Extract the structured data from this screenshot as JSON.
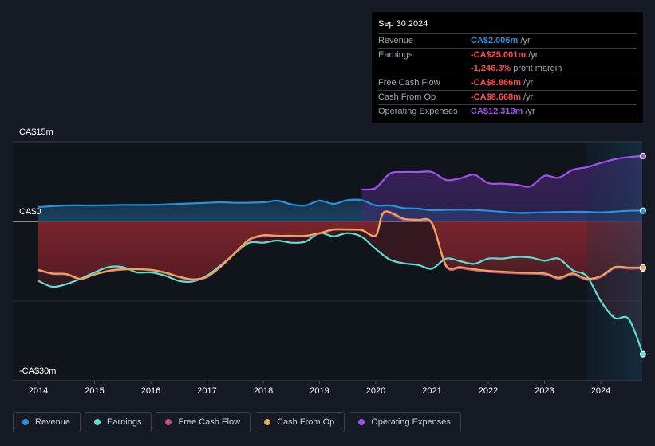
{
  "tooltip": {
    "date": "Sep 30 2024",
    "rows": [
      {
        "label": "Revenue",
        "value": "CA$2.006m",
        "suffix": " /yr",
        "color": "blue"
      },
      {
        "label": "Earnings",
        "value": "-CA$25.001m",
        "suffix": " /yr",
        "color": "red"
      },
      {
        "label": "",
        "value": "-1,246.3%",
        "suffix": " profit margin",
        "color": "red"
      },
      {
        "label": "Free Cash Flow",
        "value": "-CA$8.866m",
        "suffix": " /yr",
        "color": "red"
      },
      {
        "label": "Cash From Op",
        "value": "-CA$8.668m",
        "suffix": " /yr",
        "color": "red"
      },
      {
        "label": "Operating Expenses",
        "value": "CA$12.319m",
        "suffix": " /yr",
        "color": "purple"
      }
    ]
  },
  "colors": {
    "revenue": "#2394df",
    "earnings": "#5ce0d0",
    "free_cash_flow": "#c84b88",
    "cash_from_op": "#e8a85a",
    "operating_expenses": "#a54ff0",
    "background": "#151a24"
  },
  "chart_data": {
    "type": "line",
    "title": "",
    "xlabel": "",
    "ylabel": "",
    "y_tick_labels": [
      "CA$15m",
      "CA$0",
      "-CA$30m"
    ],
    "y_ticks": [
      15,
      0,
      -30
    ],
    "ylim": [
      -30,
      15
    ],
    "x_tick_labels": [
      "2014",
      "2015",
      "2016",
      "2017",
      "2018",
      "2019",
      "2020",
      "2021",
      "2022",
      "2023",
      "2024"
    ],
    "xlim": [
      2013.7,
      2024.75
    ],
    "grid": true,
    "legend_position": "bottom-left",
    "forecast_shade_from": 2023.75,
    "series": [
      {
        "name": "Revenue",
        "key": "revenue",
        "points": [
          [
            2014.0,
            2.7
          ],
          [
            2014.5,
            3.0
          ],
          [
            2015.0,
            3.0
          ],
          [
            2015.5,
            3.1
          ],
          [
            2016.0,
            3.1
          ],
          [
            2016.5,
            3.3
          ],
          [
            2017.0,
            3.5
          ],
          [
            2017.25,
            3.6
          ],
          [
            2017.5,
            3.5
          ],
          [
            2018.0,
            3.6
          ],
          [
            2018.25,
            3.9
          ],
          [
            2018.5,
            3.2
          ],
          [
            2018.75,
            3.0
          ],
          [
            2019.0,
            3.9
          ],
          [
            2019.25,
            3.3
          ],
          [
            2019.5,
            4.0
          ],
          [
            2019.75,
            4.0
          ],
          [
            2020.0,
            3.0
          ],
          [
            2020.25,
            3.0
          ],
          [
            2020.5,
            2.5
          ],
          [
            2020.75,
            2.4
          ],
          [
            2021.0,
            2.1
          ],
          [
            2021.5,
            2.2
          ],
          [
            2022.0,
            2.0
          ],
          [
            2022.5,
            1.6
          ],
          [
            2023.0,
            1.7
          ],
          [
            2023.5,
            1.8
          ],
          [
            2023.75,
            1.8
          ],
          [
            2024.0,
            1.7
          ],
          [
            2024.5,
            2.0
          ],
          [
            2024.75,
            2.006
          ]
        ]
      },
      {
        "name": "Earnings",
        "key": "earnings",
        "points": [
          [
            2014.0,
            -11.2
          ],
          [
            2014.25,
            -12.3
          ],
          [
            2014.5,
            -11.8
          ],
          [
            2014.75,
            -10.8
          ],
          [
            2015.0,
            -9.6
          ],
          [
            2015.25,
            -8.6
          ],
          [
            2015.5,
            -8.6
          ],
          [
            2015.75,
            -9.6
          ],
          [
            2016.0,
            -9.6
          ],
          [
            2016.25,
            -10.2
          ],
          [
            2016.5,
            -11.2
          ],
          [
            2016.75,
            -11.3
          ],
          [
            2017.0,
            -10.2
          ],
          [
            2017.25,
            -8.2
          ],
          [
            2017.5,
            -6.0
          ],
          [
            2017.75,
            -4.0
          ],
          [
            2018.0,
            -4.0
          ],
          [
            2018.25,
            -3.6
          ],
          [
            2018.5,
            -4.0
          ],
          [
            2018.75,
            -3.8
          ],
          [
            2019.0,
            -2.2
          ],
          [
            2019.25,
            -2.8
          ],
          [
            2019.5,
            -2.2
          ],
          [
            2019.75,
            -2.9
          ],
          [
            2020.0,
            -5.2
          ],
          [
            2020.25,
            -7.2
          ],
          [
            2020.5,
            -7.9
          ],
          [
            2020.75,
            -8.2
          ],
          [
            2021.0,
            -8.9
          ],
          [
            2021.25,
            -7.0
          ],
          [
            2021.5,
            -7.5
          ],
          [
            2021.75,
            -8.0
          ],
          [
            2022.0,
            -7.0
          ],
          [
            2022.25,
            -7.0
          ],
          [
            2022.5,
            -6.7
          ],
          [
            2022.75,
            -6.8
          ],
          [
            2023.0,
            -7.4
          ],
          [
            2023.25,
            -7.0
          ],
          [
            2023.5,
            -9.2
          ],
          [
            2023.75,
            -10.3
          ],
          [
            2024.0,
            -15.0
          ],
          [
            2024.25,
            -18.2
          ],
          [
            2024.5,
            -18.4
          ],
          [
            2024.75,
            -25.001
          ]
        ]
      },
      {
        "name": "Free Cash Flow",
        "key": "free_cash_flow",
        "points": [
          [
            2014.0,
            -9.2
          ],
          [
            2014.25,
            -9.9
          ],
          [
            2014.5,
            -10.0
          ],
          [
            2014.75,
            -10.9
          ],
          [
            2015.0,
            -10.0
          ],
          [
            2015.25,
            -9.4
          ],
          [
            2015.5,
            -9.1
          ],
          [
            2015.75,
            -9.0
          ],
          [
            2016.0,
            -9.2
          ],
          [
            2016.25,
            -9.7
          ],
          [
            2016.5,
            -10.5
          ],
          [
            2016.75,
            -11.0
          ],
          [
            2017.0,
            -10.5
          ],
          [
            2017.25,
            -8.5
          ],
          [
            2017.5,
            -6.0
          ],
          [
            2017.75,
            -3.5
          ],
          [
            2018.0,
            -2.8
          ],
          [
            2018.25,
            -2.8
          ],
          [
            2018.5,
            -2.8
          ],
          [
            2018.75,
            -2.8
          ],
          [
            2019.0,
            -2.3
          ],
          [
            2019.25,
            -1.6
          ],
          [
            2019.5,
            -1.6
          ],
          [
            2019.75,
            -1.7
          ],
          [
            2020.0,
            -2.7
          ],
          [
            2020.15,
            1.6
          ],
          [
            2020.5,
            0.3
          ],
          [
            2020.75,
            0.2
          ],
          [
            2021.0,
            -0.5
          ],
          [
            2021.25,
            -8.5
          ],
          [
            2021.5,
            -8.8
          ],
          [
            2021.75,
            -9.2
          ],
          [
            2022.0,
            -9.5
          ],
          [
            2022.5,
            -9.8
          ],
          [
            2023.0,
            -10.0
          ],
          [
            2023.25,
            -10.8
          ],
          [
            2023.5,
            -10.0
          ],
          [
            2023.75,
            -11.0
          ],
          [
            2024.0,
            -10.5
          ],
          [
            2024.25,
            -8.8
          ],
          [
            2024.5,
            -8.9
          ],
          [
            2024.75,
            -8.866
          ]
        ]
      },
      {
        "name": "Cash From Op",
        "key": "cash_from_op",
        "points": [
          [
            2014.0,
            -9.1
          ],
          [
            2014.25,
            -9.8
          ],
          [
            2014.5,
            -9.9
          ],
          [
            2014.75,
            -10.8
          ],
          [
            2015.0,
            -10.0
          ],
          [
            2015.25,
            -9.3
          ],
          [
            2015.5,
            -9.0
          ],
          [
            2015.75,
            -9.0
          ],
          [
            2016.0,
            -9.1
          ],
          [
            2016.25,
            -9.6
          ],
          [
            2016.5,
            -10.4
          ],
          [
            2016.75,
            -10.9
          ],
          [
            2017.0,
            -10.4
          ],
          [
            2017.25,
            -8.4
          ],
          [
            2017.5,
            -5.9
          ],
          [
            2017.75,
            -3.4
          ],
          [
            2018.0,
            -2.6
          ],
          [
            2018.25,
            -2.7
          ],
          [
            2018.5,
            -2.7
          ],
          [
            2018.75,
            -2.7
          ],
          [
            2019.0,
            -2.2
          ],
          [
            2019.25,
            -1.5
          ],
          [
            2019.5,
            -1.5
          ],
          [
            2019.75,
            -1.6
          ],
          [
            2020.0,
            -2.6
          ],
          [
            2020.15,
            1.8
          ],
          [
            2020.5,
            0.5
          ],
          [
            2020.75,
            0.3
          ],
          [
            2021.0,
            -0.3
          ],
          [
            2021.25,
            -8.3
          ],
          [
            2021.5,
            -8.6
          ],
          [
            2021.75,
            -9.0
          ],
          [
            2022.0,
            -9.3
          ],
          [
            2022.5,
            -9.6
          ],
          [
            2023.0,
            -9.8
          ],
          [
            2023.25,
            -10.6
          ],
          [
            2023.5,
            -9.8
          ],
          [
            2023.75,
            -10.8
          ],
          [
            2024.0,
            -10.3
          ],
          [
            2024.25,
            -8.6
          ],
          [
            2024.5,
            -8.7
          ],
          [
            2024.75,
            -8.668
          ]
        ]
      },
      {
        "name": "Operating Expenses",
        "key": "operating_expenses",
        "points": [
          [
            2019.75,
            6.0
          ],
          [
            2020.0,
            6.3
          ],
          [
            2020.25,
            9.0
          ],
          [
            2020.5,
            9.3
          ],
          [
            2020.75,
            9.3
          ],
          [
            2021.0,
            9.3
          ],
          [
            2021.25,
            7.8
          ],
          [
            2021.5,
            8.1
          ],
          [
            2021.75,
            8.8
          ],
          [
            2022.0,
            7.2
          ],
          [
            2022.25,
            7.1
          ],
          [
            2022.5,
            6.9
          ],
          [
            2022.75,
            6.6
          ],
          [
            2023.0,
            8.6
          ],
          [
            2023.25,
            8.2
          ],
          [
            2023.5,
            9.7
          ],
          [
            2023.75,
            10.2
          ],
          [
            2024.0,
            11.0
          ],
          [
            2024.25,
            11.7
          ],
          [
            2024.5,
            12.1
          ],
          [
            2024.75,
            12.319
          ]
        ]
      }
    ]
  },
  "legend": [
    {
      "label": "Revenue",
      "key": "revenue"
    },
    {
      "label": "Earnings",
      "key": "earnings"
    },
    {
      "label": "Free Cash Flow",
      "key": "free_cash_flow"
    },
    {
      "label": "Cash From Op",
      "key": "cash_from_op"
    },
    {
      "label": "Operating Expenses",
      "key": "operating_expenses"
    }
  ]
}
